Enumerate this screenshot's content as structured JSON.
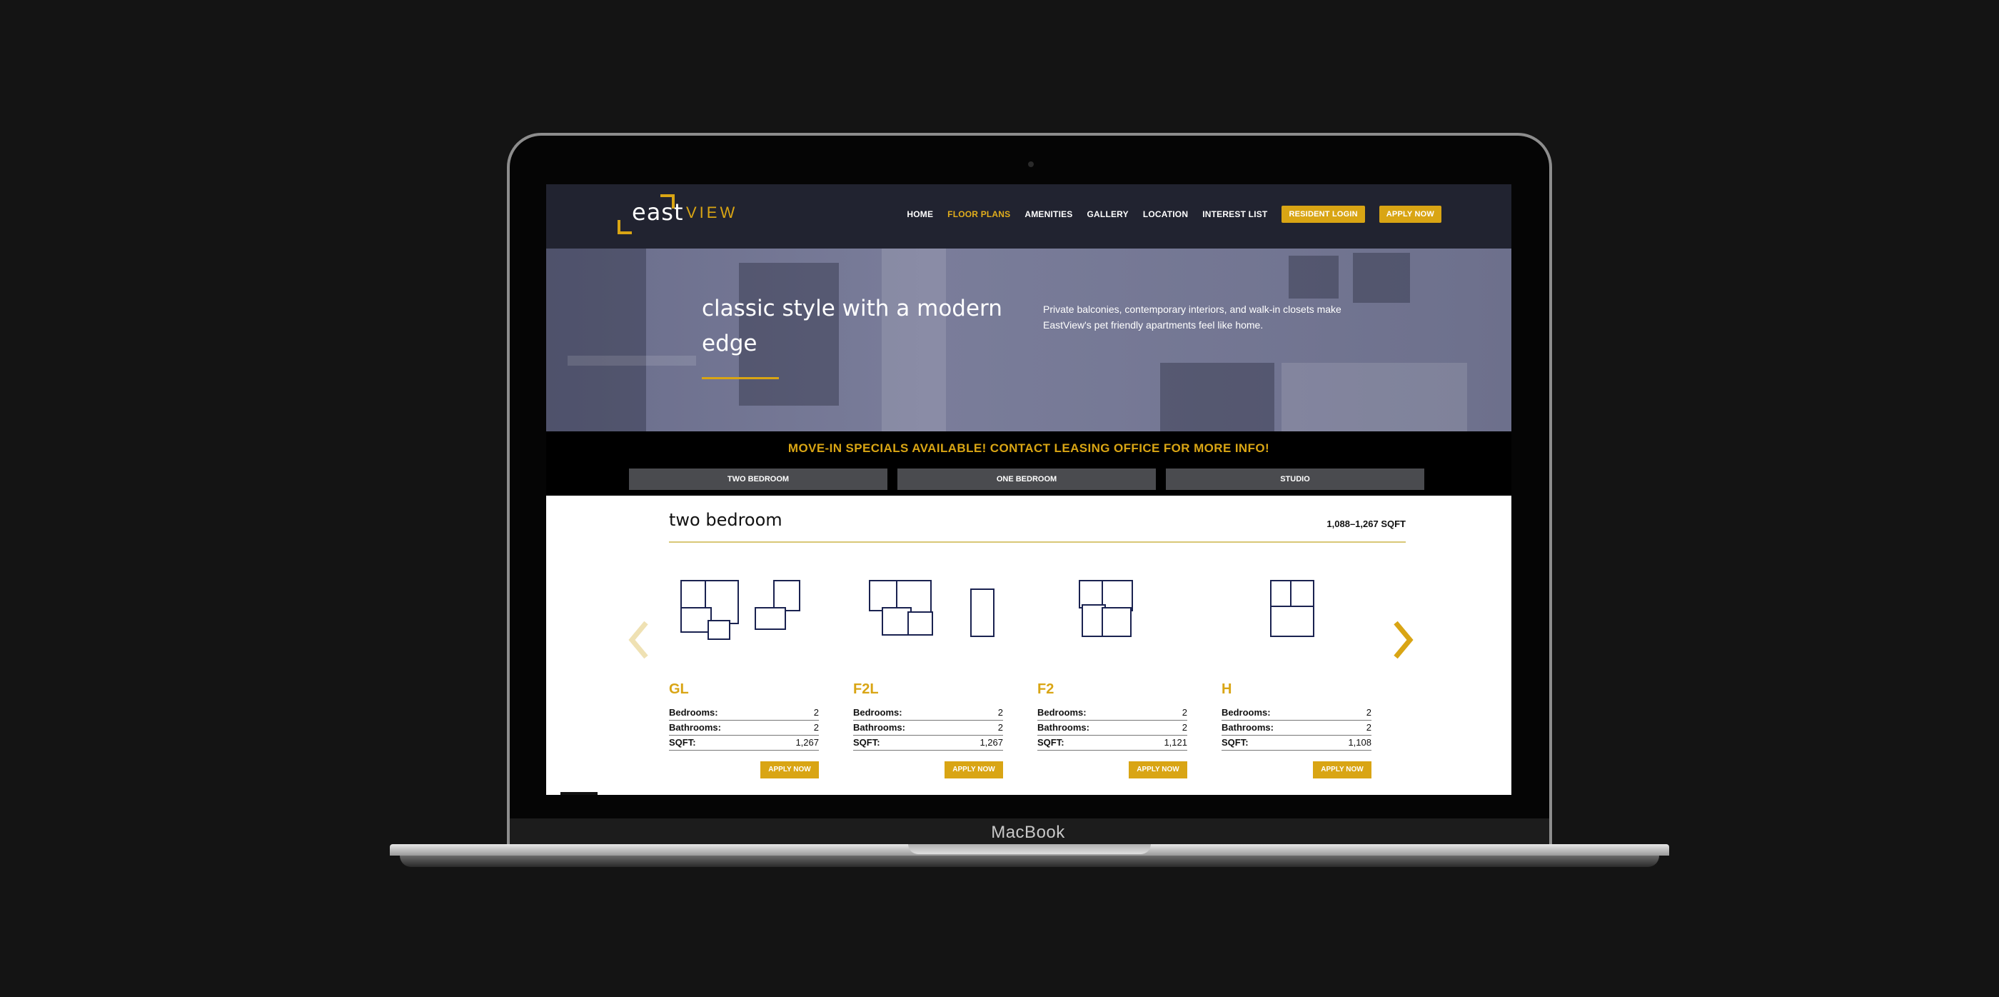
{
  "device": {
    "label": "MacBook"
  },
  "site": {
    "logo": {
      "part1": "east",
      "part2": "VIEW"
    },
    "nav": {
      "home": "HOME",
      "floor_plans": "FLOOR PLANS",
      "amenities": "AMENITIES",
      "gallery": "GALLERY",
      "location": "LOCATION",
      "interest_list": "INTEREST LIST",
      "resident_login": "RESIDENT LOGIN",
      "apply_now": "APPLY NOW"
    },
    "hero": {
      "title": "classic style with a modern edge",
      "description": "Private balconies, contemporary interiors, and walk-in closets make EastView's pet friendly apartments feel like home."
    },
    "promo": "MOVE-IN SPECIALS AVAILABLE! CONTACT LEASING OFFICE FOR MORE INFO!",
    "tabs": [
      "TWO BEDROOM",
      "ONE BEDROOM",
      "STUDIO"
    ],
    "section": {
      "title": "two bedroom",
      "sqft_range": "1,088–1,267 SQFT"
    },
    "spec_labels": {
      "bedrooms": "Bedrooms:",
      "bathrooms": "Bathrooms:",
      "sqft": "SQFT:"
    },
    "plans": [
      {
        "name": "GL",
        "bedrooms": "2",
        "bathrooms": "2",
        "sqft": "1,267",
        "apply": "APPLY NOW"
      },
      {
        "name": "F2L",
        "bedrooms": "2",
        "bathrooms": "2",
        "sqft": "1,267",
        "apply": "APPLY NOW"
      },
      {
        "name": "F2",
        "bedrooms": "2",
        "bathrooms": "2",
        "sqft": "1,121",
        "apply": "APPLY NOW"
      },
      {
        "name": "H",
        "bedrooms": "2",
        "bathrooms": "2",
        "sqft": "1,108",
        "apply": "APPLY NOW"
      }
    ],
    "colors": {
      "accent": "#d9a514",
      "header": "#212330",
      "tab": "#4a4b4f"
    },
    "icons": {
      "prev": "chevron-left-icon",
      "next": "chevron-right-icon"
    }
  }
}
